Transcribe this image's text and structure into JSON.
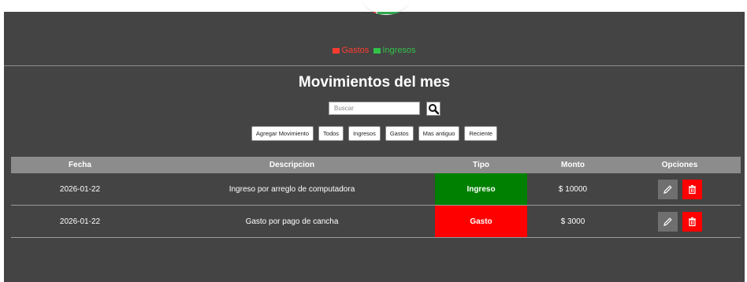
{
  "legend": {
    "gastos_label": "Gastos",
    "ingresos_label": "Ingresos",
    "gastos_color": "#ff3b30",
    "ingresos_color": "#31c24a"
  },
  "header": {
    "title": "Movimientos del mes"
  },
  "search": {
    "placeholder": "Buscar",
    "button_icon": "search-icon"
  },
  "filters": {
    "add_label": "Agregar Movimiento",
    "all_label": "Todos",
    "income_label": "Ingresos",
    "expense_label": "Gastos",
    "oldest_label": "Mas antiguo",
    "recent_label": "Reciente"
  },
  "table": {
    "columns": [
      "Fecha",
      "Descripcion",
      "Tipo",
      "Monto",
      "Opciones"
    ],
    "rows": [
      {
        "fecha": "2026-01-22",
        "descripcion": "Ingreso por arreglo de computadora",
        "tipo": "Ingreso",
        "monto": "$ 10000",
        "tipo_color": "#008000"
      },
      {
        "fecha": "2026-01-22",
        "descripcion": "Gasto por pago de cancha",
        "tipo": "Gasto",
        "monto": "$ 3000",
        "tipo_color": "#ff0000"
      }
    ],
    "edit_icon": "pencil-icon",
    "delete_icon": "trash-icon"
  }
}
